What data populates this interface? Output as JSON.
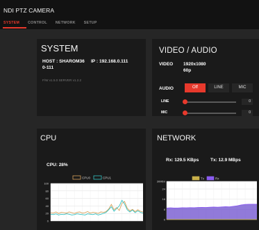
{
  "header": {
    "title": "NDI PTZ CAMERA",
    "tabs": [
      {
        "label": "SYSTEM",
        "active": true
      },
      {
        "label": "CONTROL",
        "active": false
      },
      {
        "label": "NETWORK",
        "active": false
      },
      {
        "label": "SETUP",
        "active": false
      }
    ]
  },
  "system": {
    "title": "SYSTEM",
    "host_line": "HOST : SHAROM36     IP : 192.168.0.111",
    "host_line2": "0-111",
    "firmware": "F/W v1.5.0    SERVER v1.2.2"
  },
  "video_audio": {
    "title": "VIDEO / AUDIO",
    "video_label": "VIDEO",
    "video_res": "1920x1080",
    "video_rate": "60p",
    "audio_label": "AUDIO",
    "audio_options": [
      "Off",
      "LINE",
      "MIC"
    ],
    "audio_selected": "Off",
    "line_label": "LINE",
    "line_value": "0",
    "mic_label": "MIC",
    "mic_value": "0"
  },
  "cpu": {
    "title": "CPU",
    "usage_text": "CPU: 28%",
    "legend": [
      "CPU0",
      "CPU1"
    ]
  },
  "network": {
    "title": "NETWORK",
    "rx_text": "Rx: 129.5 KBps",
    "tx_text": "Tx: 12.9 MBps",
    "legend": [
      "Tx",
      "Rx"
    ]
  },
  "colors": {
    "accent": "#e8392c",
    "cpu0": "#d9a15a",
    "cpu1": "#35c2c2",
    "tx": "#c8b04a",
    "rx": "#8a5cf0"
  },
  "chart_data": [
    {
      "type": "line",
      "title": "CPU",
      "ylim": [
        0,
        100
      ],
      "yticks": [
        "100",
        "80",
        "60",
        "40",
        "20",
        "0"
      ],
      "grid": true,
      "legend": "top-center",
      "x": [
        0,
        1,
        2,
        3,
        4,
        5,
        6,
        7,
        8,
        9,
        10,
        11,
        12,
        13,
        14,
        15,
        16,
        17,
        18,
        19,
        20,
        21,
        22,
        23,
        24,
        25,
        26,
        27,
        28,
        29,
        30,
        31,
        32,
        33,
        34,
        35
      ],
      "series": [
        {
          "name": "CPU0",
          "values": [
            22,
            21,
            24,
            20,
            23,
            22,
            21,
            24,
            22,
            20,
            23,
            24,
            21,
            22,
            25,
            21,
            23,
            22,
            20,
            24,
            23,
            25,
            32,
            44,
            30,
            36,
            28,
            47,
            52,
            34,
            27,
            31,
            25,
            30,
            26,
            24
          ]
        },
        {
          "name": "CPU1",
          "values": [
            18,
            17,
            19,
            16,
            18,
            17,
            19,
            18,
            16,
            17,
            19,
            18,
            17,
            16,
            19,
            18,
            17,
            19,
            16,
            18,
            20,
            23,
            30,
            38,
            26,
            33,
            40,
            55,
            45,
            30,
            24,
            29,
            22,
            27,
            23,
            21
          ]
        }
      ]
    },
    {
      "type": "area",
      "title": "NETWORK",
      "yticks": [
        "30Mbn",
        "24",
        "16",
        "8",
        "0"
      ],
      "grid": true,
      "legend": "top-center",
      "x": [
        0,
        1,
        2,
        3,
        4,
        5,
        6,
        7,
        8,
        9,
        10,
        11,
        12,
        13,
        14,
        15,
        16,
        17,
        18,
        19,
        20,
        21,
        22,
        23
      ],
      "series": [
        {
          "name": "Tx",
          "values": [
            9,
            9.2,
            9,
            9.1,
            9.3,
            9.2,
            9.4,
            9.3,
            9.5,
            9.6,
            9.5,
            9.7,
            9.8,
            9.7,
            9.9,
            10.1,
            10,
            10.4,
            10.8,
            11.5,
            11.9,
            12,
            12,
            12
          ]
        },
        {
          "name": "Rx",
          "values": [
            0.1,
            0.1,
            0.1,
            0.1,
            0.1,
            0.1,
            0.1,
            0.1,
            0.1,
            0.1,
            0.1,
            0.1,
            0.1,
            0.1,
            0.1,
            0.1,
            0.1,
            0.1,
            0.1,
            0.1,
            0.1,
            0.1,
            0.1,
            0.1
          ]
        }
      ]
    }
  ]
}
